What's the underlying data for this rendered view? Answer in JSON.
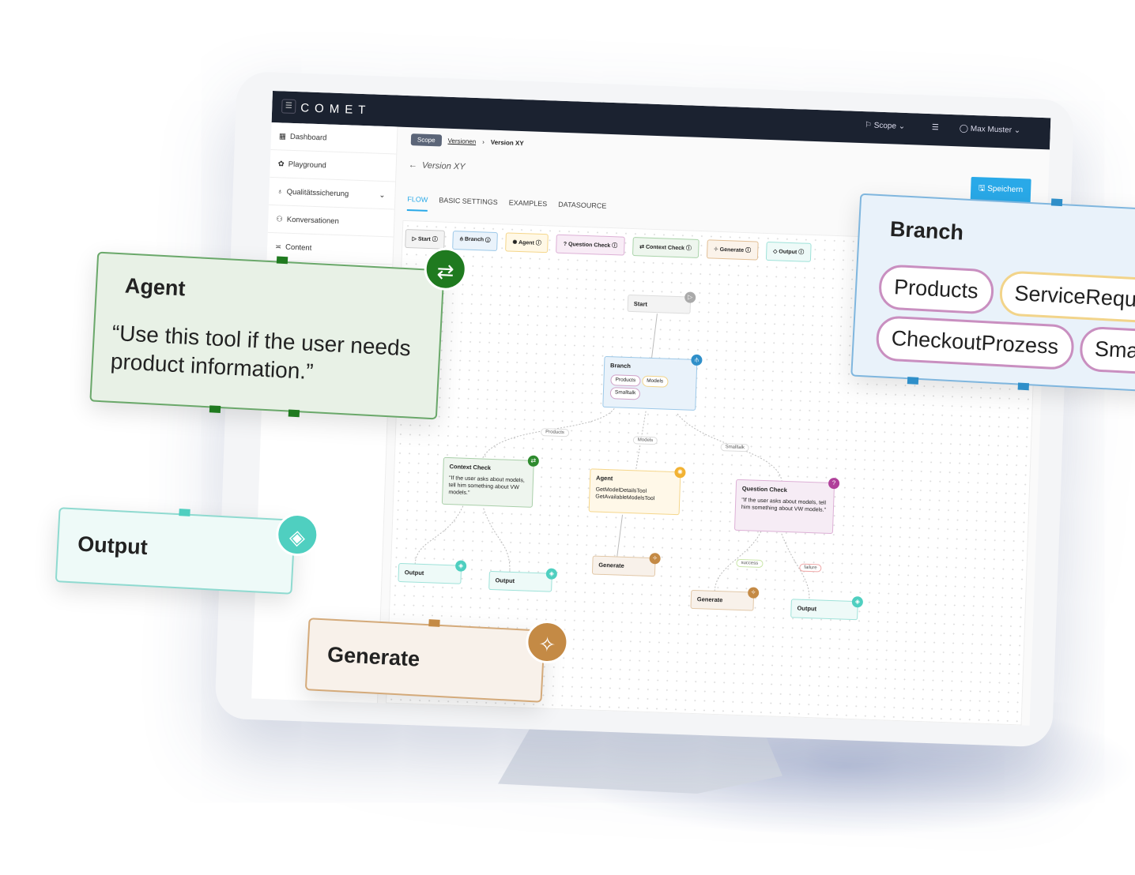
{
  "app": {
    "logo": "COMET"
  },
  "header": {
    "scope": "Scope",
    "user": "Max Muster"
  },
  "sidebar": {
    "items": [
      {
        "label": "Dashboard",
        "icon": "dashboard-icon"
      },
      {
        "label": "Playground",
        "icon": "playground-icon"
      },
      {
        "label": "Qualitätssicherung",
        "icon": "award-icon"
      },
      {
        "label": "Konversationen",
        "icon": "users-icon"
      },
      {
        "label": "Content",
        "icon": "content-icon"
      }
    ]
  },
  "breadcrumb": {
    "scope": "Scope",
    "versions": "Versionen",
    "current": "Version XY"
  },
  "page": {
    "title": "Version XY",
    "save_label": "Speichern"
  },
  "tabs": [
    {
      "label": "FLOW"
    },
    {
      "label": "BASIC SETTINGS"
    },
    {
      "label": "EXAMPLES"
    },
    {
      "label": "DATASOURCE"
    }
  ],
  "palette": [
    {
      "label": "Start",
      "color": "#9e9e9e"
    },
    {
      "label": "Branch",
      "color": "#2f8fc9"
    },
    {
      "label": "Agent",
      "color": "#f2b233"
    },
    {
      "label": "Question Check",
      "color": "#b0409a"
    },
    {
      "label": "Context Check",
      "color": "#2e8b2e"
    },
    {
      "label": "Generate",
      "color": "#c48a45"
    },
    {
      "label": "Output",
      "color": "#4fcfc0"
    }
  ],
  "flow": {
    "start": "Start",
    "branch": {
      "title": "Branch",
      "options": [
        "Products",
        "Models",
        "Smalltalk"
      ]
    },
    "context_check": {
      "title": "Context Check",
      "text": "\"If the user asks about models, tell him something about VW models.\""
    },
    "agent": {
      "title": "Agent",
      "tools": [
        "GetModelDetailsTool",
        "GetAvailableModelsTool"
      ]
    },
    "question_check": {
      "title": "Question Check",
      "text": "\"If the user asks about models, tell him something about VW models.\""
    },
    "output": "Output",
    "generate": "Generate",
    "edge_labels": {
      "products": "Products",
      "models": "Models",
      "smalltalk": "Smalltalk",
      "success": "success",
      "failure": "failure"
    }
  },
  "cards": {
    "agent": {
      "title": "Agent",
      "text": "“Use this tool if the user needs product information.”"
    },
    "output": {
      "title": "Output"
    },
    "generate": {
      "title": "Generate"
    },
    "branch": {
      "title": "Branch",
      "options": [
        "Products",
        "ServiceReque",
        "CheckoutProzess",
        "Smallt"
      ]
    }
  }
}
